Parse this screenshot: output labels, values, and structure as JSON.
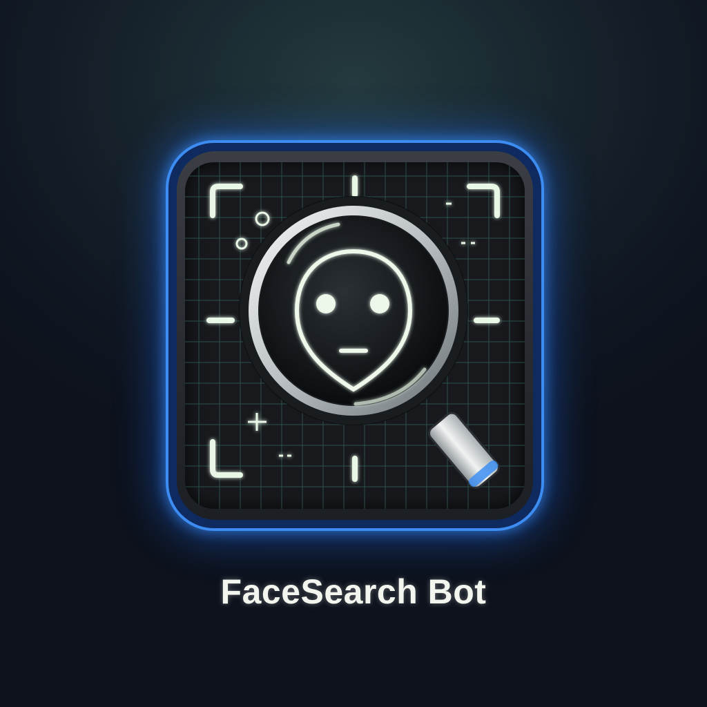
{
  "app": {
    "name": "FaceSearch Bot",
    "icon": "magnifying-glass-face-scan-icon"
  },
  "colors": {
    "background": "#121a24",
    "tile_border": "#3d8cf2",
    "glow": "#1e6eff",
    "line_glow": "#e9f7e6",
    "grid": "#3f7f73",
    "title": "#f2f6ee"
  }
}
